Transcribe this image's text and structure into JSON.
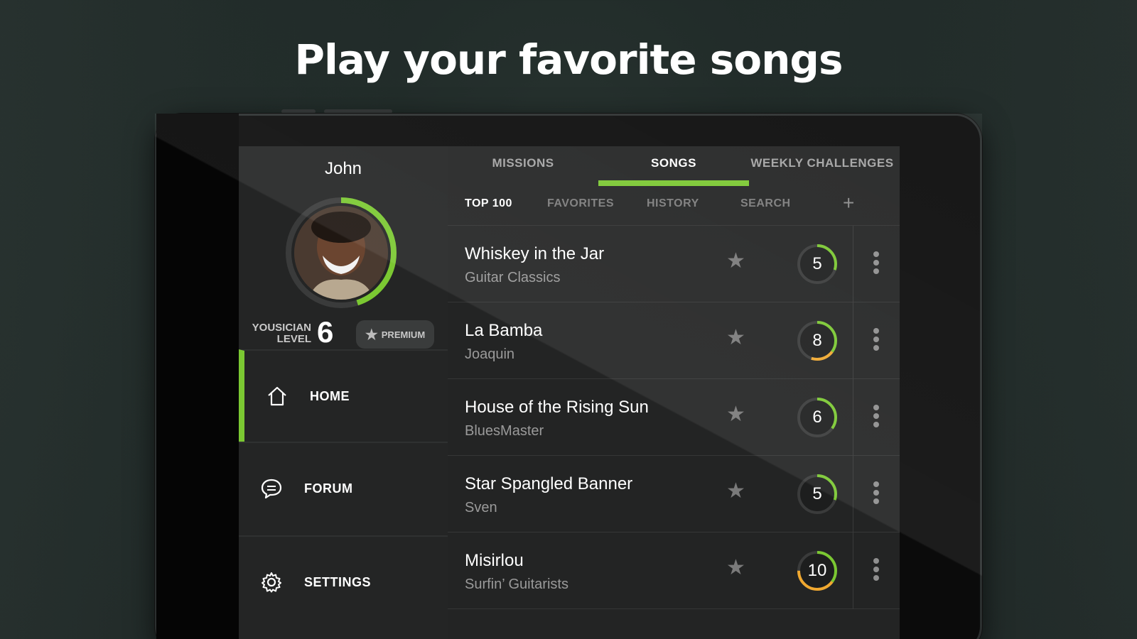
{
  "headline": "Play your favorite songs",
  "profile": {
    "name": "John",
    "level_label_line1": "YOUSICIAN",
    "level_label_line2": "LEVEL",
    "level": "6",
    "level_progress": 0.45,
    "premium_label": "PREMIUM"
  },
  "nav": {
    "items": [
      {
        "label": "HOME",
        "icon": "home-icon",
        "active": true
      },
      {
        "label": "FORUM",
        "icon": "chat-bubble-icon",
        "active": false
      },
      {
        "label": "SETTINGS",
        "icon": "gear-icon",
        "active": false
      }
    ]
  },
  "tabs": [
    {
      "label": "MISSIONS",
      "active": false
    },
    {
      "label": "SONGS",
      "active": true
    },
    {
      "label": "WEEKLY CHALLENGES",
      "active": false
    }
  ],
  "subtabs": [
    {
      "label": "TOP 100",
      "active": true
    },
    {
      "label": "FAVORITES",
      "active": false
    },
    {
      "label": "HISTORY",
      "active": false
    },
    {
      "label": "SEARCH",
      "active": false
    }
  ],
  "add_label": "+",
  "songs": [
    {
      "title": "Whiskey in the Jar",
      "artist": "Guitar Classics",
      "difficulty": "5",
      "progress": 0.3
    },
    {
      "title": "La Bamba",
      "artist": "Joaquin",
      "difficulty": "8",
      "progress": 0.55
    },
    {
      "title": "House of the Rising Sun",
      "artist": "BluesMaster",
      "difficulty": "6",
      "progress": 0.35
    },
    {
      "title": "Star Spangled Banner",
      "artist": "Sven",
      "difficulty": "5",
      "progress": 0.3
    },
    {
      "title": "Misirlou",
      "artist": "Surfin’ Guitarists",
      "difficulty": "10",
      "progress": 0.75
    }
  ],
  "colors": {
    "accent": "#7bc832",
    "accent_orange": "#f0a830"
  }
}
